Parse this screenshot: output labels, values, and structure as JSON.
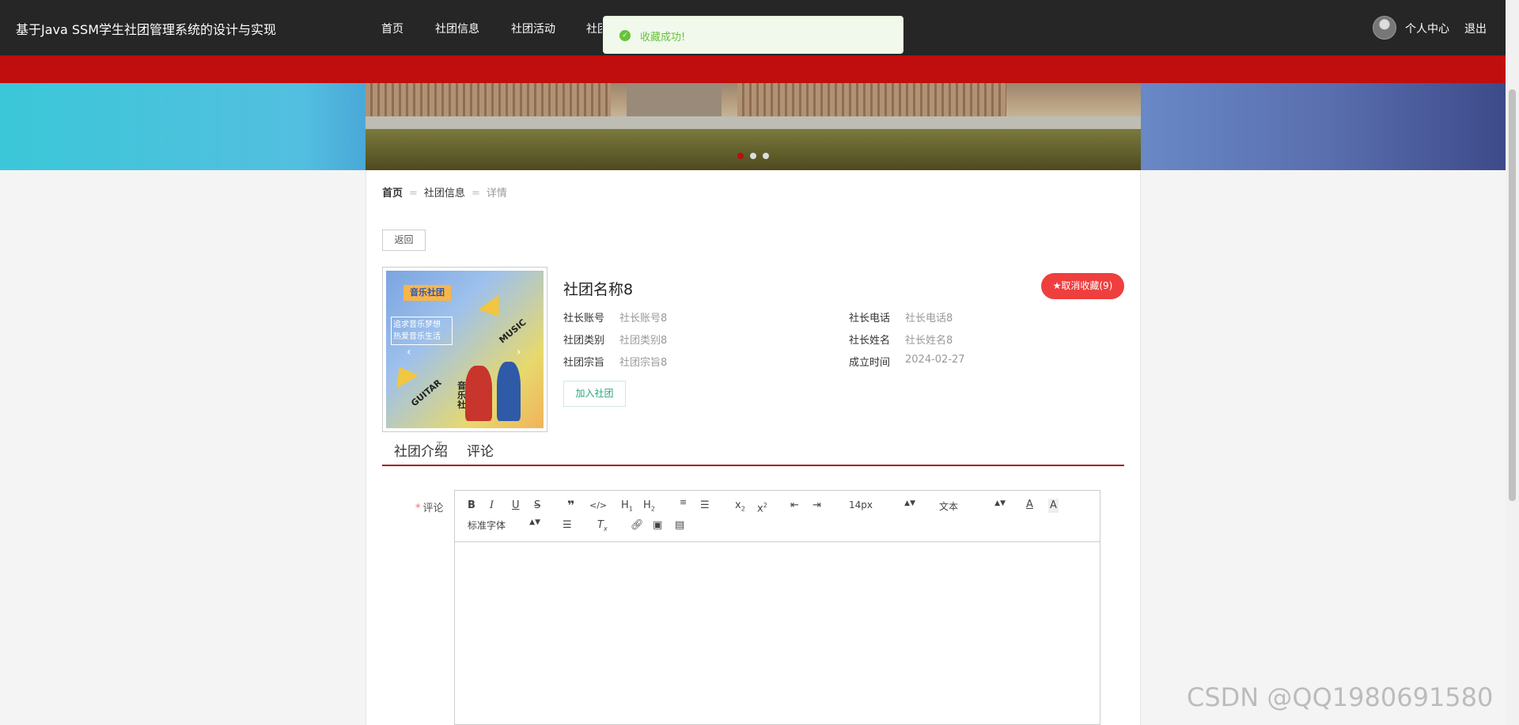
{
  "header": {
    "site_title": "基于Java SSM学生社团管理系统的设计与实现",
    "nav": [
      "首页",
      "社团信息",
      "社团活动",
      "社团"
    ],
    "user_center": "个人中心",
    "logout": "退出"
  },
  "toast": {
    "message": "收藏成功!"
  },
  "carousel": {
    "count": 3,
    "active_index": 0
  },
  "breadcrumb": {
    "home": "首页",
    "separator": "=",
    "section": "社团信息",
    "current": "详情"
  },
  "back_button": "返回",
  "poster": {
    "title": "音乐社团",
    "box_text": "追求音乐梦想 热爱音乐生活",
    "words": [
      "MUSIC",
      "GUITAR",
      "音乐社"
    ]
  },
  "club": {
    "name": "社团名称8",
    "favorite_button": "★取消收藏(9)",
    "fields": [
      {
        "label": "社长账号",
        "value": "社长账号8"
      },
      {
        "label": "社长电话",
        "value": "社长电话8"
      },
      {
        "label": "社团类别",
        "value": "社团类别8"
      },
      {
        "label": "社长姓名",
        "value": "社长姓名8"
      },
      {
        "label": "社团宗旨",
        "value": "社团宗旨8"
      },
      {
        "label": "成立时间",
        "value": "2024-02-27"
      }
    ],
    "join_button": "加入社团"
  },
  "tabs": [
    "社团介绍",
    "评论"
  ],
  "comment": {
    "label": "评论",
    "required_mark": "*",
    "toolbar": {
      "font_size": "14px",
      "text_style": "文本",
      "font_family": "标准字体"
    }
  },
  "watermark": "CSDN @QQ1980691580",
  "colors": {
    "topbar": "#262626",
    "accent_red": "#c00d0d",
    "favorite_red": "#ef3e3e",
    "success_green": "#67c23a",
    "join_green": "#2aa77a"
  }
}
